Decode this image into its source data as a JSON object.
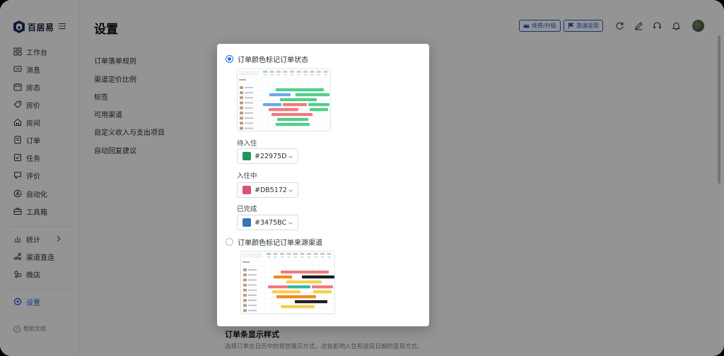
{
  "app": {
    "name": "百居易"
  },
  "page": {
    "title": "设置"
  },
  "header": {
    "renew_label": "续费/升级",
    "invite_label": "邀请返现"
  },
  "nav": [
    {
      "label": "工作台",
      "icon": "grid-icon"
    },
    {
      "label": "消息",
      "icon": "message-icon"
    },
    {
      "label": "房态",
      "icon": "calendar-icon"
    },
    {
      "label": "房价",
      "icon": "tag-icon"
    },
    {
      "label": "房间",
      "icon": "home-icon"
    },
    {
      "label": "订单",
      "icon": "order-icon"
    },
    {
      "label": "任务",
      "icon": "task-icon"
    },
    {
      "label": "评价",
      "icon": "comment-icon"
    },
    {
      "label": "自动化",
      "icon": "auto-icon"
    },
    {
      "label": "工具箱",
      "icon": "toolbox-icon"
    },
    {
      "label": "统计",
      "icon": "chart-icon"
    },
    {
      "label": "渠道直连",
      "icon": "link-icon"
    },
    {
      "label": "微店",
      "icon": "store-icon"
    },
    {
      "label": "设置",
      "icon": "gear-icon"
    }
  ],
  "help": {
    "label": "帮助文档"
  },
  "settings_menu": [
    "订单落单规则",
    "渠道定价比例",
    "标签",
    "可用渠道",
    "自定义收入与支出项目",
    "自动回复建议"
  ],
  "section": {
    "title": "订单条显示样式",
    "desc": "选择订单在日历中的视觉展示方式，这会影响入住和退房日期的呈现方式。"
  },
  "popover": {
    "option1": {
      "label": "订单颜色标记订单状态",
      "selected": true
    },
    "option2": {
      "label": "订单颜色标记订单来源渠道",
      "selected": false
    },
    "status_colors": [
      {
        "label": "待入住",
        "value": "#22975D"
      },
      {
        "label": "入住中",
        "value": "#DB5172"
      },
      {
        "label": "已完成",
        "value": "#3475BC"
      }
    ]
  },
  "colors": {
    "accent": "#1f6fe5",
    "thumb_green": "#4fd08b",
    "thumb_red": "#f07a7f",
    "thumb_blue": "#6aa6ee",
    "thumb_orange": "#f5891f",
    "thumb_yellow": "#f7d04a",
    "thumb_black": "#1d1d1d",
    "thumb_teal": "#35b8a8"
  }
}
